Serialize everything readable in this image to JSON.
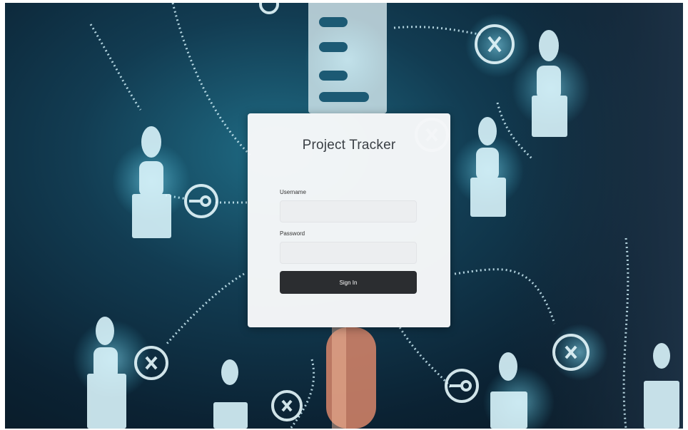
{
  "app": {
    "title": "Project Tracker"
  },
  "login": {
    "username_label": "Username",
    "username_value": "",
    "username_placeholder": "",
    "password_label": "Password",
    "password_value": "",
    "password_placeholder": "",
    "signin_label": "Sign In"
  },
  "background": {
    "base_color": "#0b2233",
    "glow_color": "#4fd3f0",
    "icons": [
      "user-icon",
      "key-icon",
      "close-icon",
      "document-icon",
      "hand-icon"
    ]
  }
}
